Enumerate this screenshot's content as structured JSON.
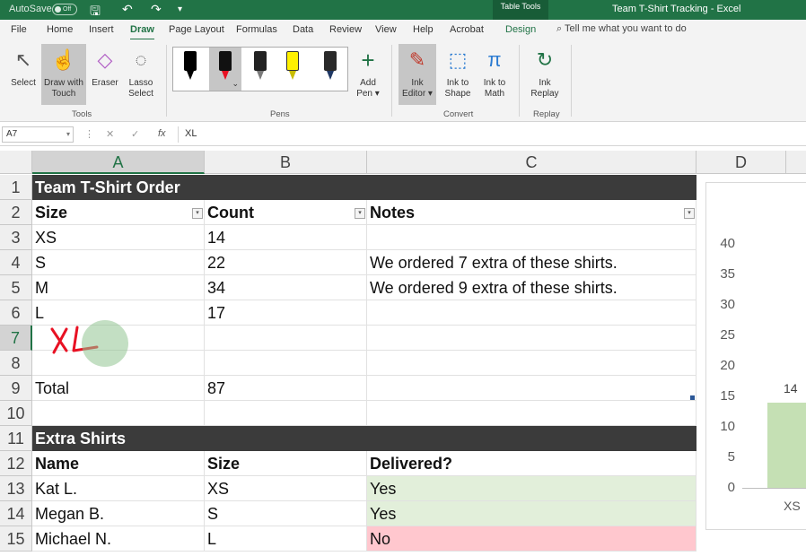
{
  "titlebar": {
    "autosave_label": "AutoSave",
    "autosave_state": "Off",
    "context_tab": "Table Tools",
    "window_title": "Team T-Shirt Tracking  -  Excel"
  },
  "ribbon_tabs": [
    "File",
    "Home",
    "Insert",
    "Draw",
    "Page Layout",
    "Formulas",
    "Data",
    "Review",
    "View",
    "Help",
    "Acrobat",
    "Design"
  ],
  "active_tab": "Draw",
  "tell_me": "Tell me what you want to do",
  "ribbon": {
    "tools": {
      "select": "Select",
      "draw_touch_1": "Draw with",
      "draw_touch_2": "Touch",
      "eraser": "Eraser",
      "lasso_1": "Lasso",
      "lasso_2": "Select",
      "group": "Tools"
    },
    "pens": {
      "add_pen_1": "Add",
      "add_pen_2": "Pen",
      "group": "Pens",
      "colors": [
        "#000000",
        "#e81123",
        "#4a4a4a",
        "#fff100",
        "#1f3864"
      ]
    },
    "convert": {
      "ink_editor_1": "Ink",
      "ink_editor_2": "Editor",
      "ink_shape_1": "Ink to",
      "ink_shape_2": "Shape",
      "ink_math_1": "Ink to",
      "ink_math_2": "Math",
      "group": "Convert"
    },
    "replay": {
      "ink_replay_1": "Ink",
      "ink_replay_2": "Replay",
      "group": "Replay"
    }
  },
  "formula_bar": {
    "name_box": "A7",
    "value": "XL"
  },
  "columns": [
    "A",
    "B",
    "C",
    "D"
  ],
  "rows": [
    "1",
    "2",
    "3",
    "4",
    "5",
    "6",
    "7",
    "8",
    "9",
    "10",
    "11",
    "12",
    "13",
    "14",
    "15"
  ],
  "sheet": {
    "order_title": "Team T-Shirt Order",
    "order_headers": [
      "Size",
      "Count",
      "Notes"
    ],
    "order_rows": [
      [
        "XS",
        "14",
        ""
      ],
      [
        "S",
        "22",
        "We ordered 7 extra of these shirts."
      ],
      [
        "M",
        "34",
        "We ordered 9 extra of these shirts."
      ],
      [
        "L",
        "17",
        ""
      ]
    ],
    "total_label": "Total",
    "total_value": "87",
    "ink_annotation": "XL",
    "extra_title": "Extra Shirts",
    "extra_headers": [
      "Name",
      "Size",
      "Delivered?"
    ],
    "extra_rows": [
      [
        "Kat L.",
        "XS",
        "Yes"
      ],
      [
        "Megan B.",
        "S",
        "Yes"
      ],
      [
        "Michael N.",
        "L",
        "No"
      ]
    ]
  },
  "colors": {
    "excel_green": "#217346",
    "header_fill": "#3b3b3b",
    "yes_fill": "#e2efda",
    "no_fill": "#ffc7ce",
    "bar_fill": "#c5e0b4",
    "ink_red": "#e81123"
  },
  "chart_data": {
    "type": "bar",
    "categories": [
      "XS"
    ],
    "values": [
      14
    ],
    "data_labels": [
      "14"
    ],
    "yticks": [
      "0",
      "5",
      "10",
      "15",
      "20",
      "25",
      "30",
      "35",
      "40"
    ],
    "ylim": [
      0,
      40
    ],
    "title": "",
    "xlabel": "",
    "ylabel": ""
  }
}
